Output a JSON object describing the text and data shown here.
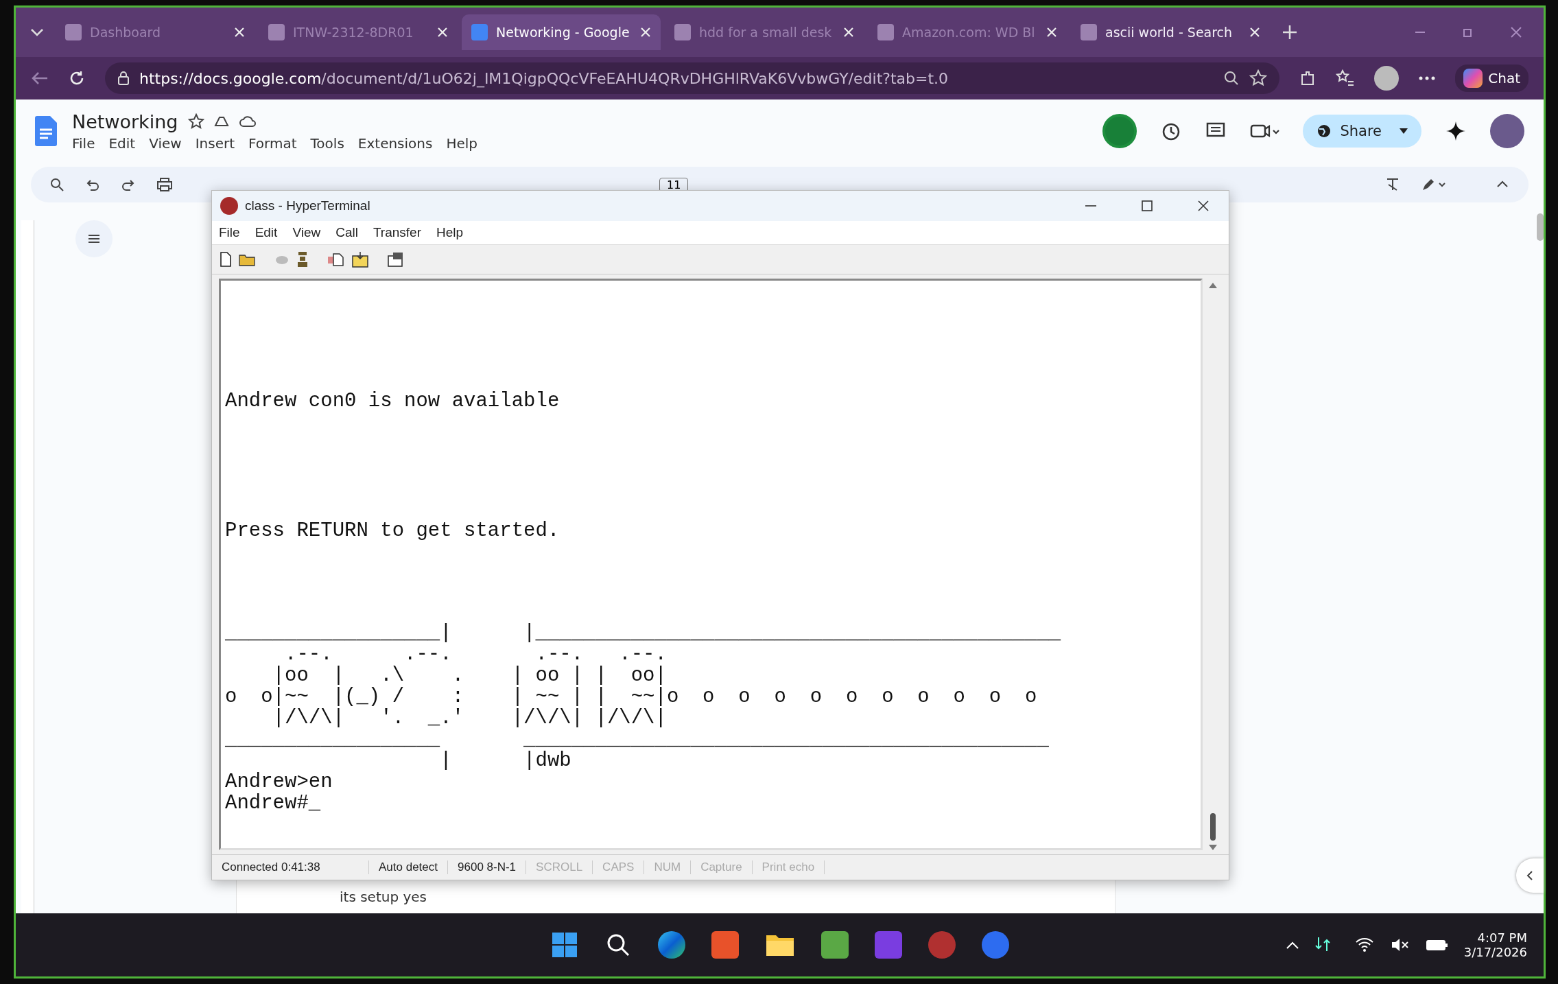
{
  "browser": {
    "tabs": [
      {
        "label": "Dashboard",
        "selected": false,
        "dim": true
      },
      {
        "label": "ITNW-2312-8DR01",
        "selected": false,
        "dim": true
      },
      {
        "label": "Networking - Google",
        "selected": true,
        "dim": false
      },
      {
        "label": "hdd for a small desk",
        "selected": false,
        "dim": true
      },
      {
        "label": "Amazon.com: WD Bl",
        "selected": false,
        "dim": true
      },
      {
        "label": "ascii world - Search",
        "selected": false,
        "dim": false
      }
    ],
    "url_host": "https://docs.google.com",
    "url_path": "/document/d/1uO62j_IM1QigpQQcVFeEAHU4QRvDHGHlRVaK6VvbwGY/edit?tab=t.0",
    "chat": "Chat"
  },
  "doc": {
    "title": "Networking",
    "menu": [
      "File",
      "Edit",
      "View",
      "Insert",
      "Format",
      "Tools",
      "Extensions",
      "Help"
    ],
    "share": "Share",
    "font_size": "11",
    "body_text": "its setup yes"
  },
  "terminal": {
    "title": "class - HyperTerminal",
    "menu": [
      "File",
      "Edit",
      "View",
      "Call",
      "Transfer",
      "Help"
    ],
    "messages": [
      "Andrew con0 is now available",
      "Press RETURN to get started."
    ],
    "art": [
      "__________________|      |____________________________________________",
      "     .--.      .--.       .--.   .--.",
      "    |oo  |   .\\    .    | oo | |  oo|",
      "o  o|~~  |(_) /    :    | ~~ | |  ~~|o  o  o  o  o  o  o  o  o  o  o",
      "    |/\\/\\|   '.  _.'    |/\\/\\| |/\\/\\|",
      "__________________       ____________________________________________",
      "                  |      |dwb"
    ],
    "prompt": [
      "Andrew>en",
      "Andrew#_"
    ],
    "status": [
      {
        "text": "Connected 0:41:38",
        "disabled": false
      },
      {
        "text": "Auto detect",
        "disabled": false
      },
      {
        "text": "9600 8-N-1",
        "disabled": false
      },
      {
        "text": "SCROLL",
        "disabled": true
      },
      {
        "text": "CAPS",
        "disabled": true
      },
      {
        "text": "NUM",
        "disabled": true
      },
      {
        "text": "Capture",
        "disabled": true
      },
      {
        "text": "Print echo",
        "disabled": true
      }
    ]
  },
  "taskbar": {
    "time": "4:07 PM",
    "date": "3/17/2026"
  }
}
